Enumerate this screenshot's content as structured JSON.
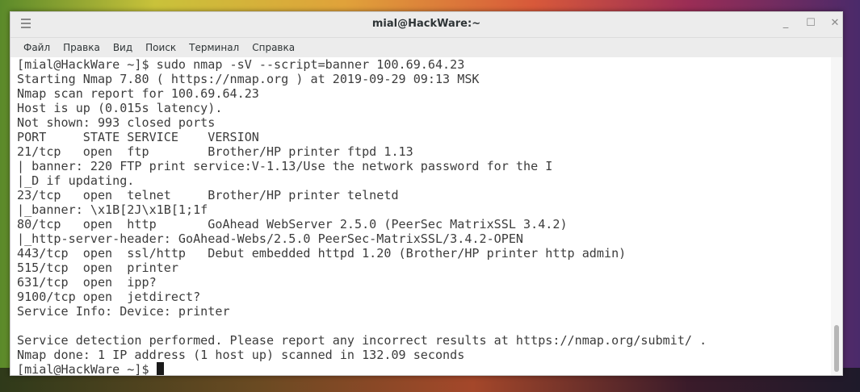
{
  "window": {
    "title": "mial@HackWare:~",
    "controls": {
      "minimize": "_",
      "maximize": "☐",
      "close": "✕"
    }
  },
  "menubar": {
    "items": [
      "Файл",
      "Правка",
      "Вид",
      "Поиск",
      "Терминал",
      "Справка"
    ]
  },
  "terminal": {
    "lines": [
      "[mial@HackWare ~]$ sudo nmap -sV --script=banner 100.69.64.23",
      "Starting Nmap 7.80 ( https://nmap.org ) at 2019-09-29 09:13 MSK",
      "Nmap scan report for 100.69.64.23",
      "Host is up (0.015s latency).",
      "Not shown: 993 closed ports",
      "PORT     STATE SERVICE    VERSION",
      "21/tcp   open  ftp        Brother/HP printer ftpd 1.13",
      "| banner: 220 FTP print service:V-1.13/Use the network password for the I",
      "|_D if updating.",
      "23/tcp   open  telnet     Brother/HP printer telnetd",
      "|_banner: \\x1B[2J\\x1B[1;1f",
      "80/tcp   open  http       GoAhead WebServer 2.5.0 (PeerSec MatrixSSL 3.4.2)",
      "|_http-server-header: GoAhead-Webs/2.5.0 PeerSec-MatrixSSL/3.4.2-OPEN",
      "443/tcp  open  ssl/http   Debut embedded httpd 1.20 (Brother/HP printer http admin)",
      "515/tcp  open  printer",
      "631/tcp  open  ipp?",
      "9100/tcp open  jetdirect?",
      "Service Info: Device: printer",
      "",
      "Service detection performed. Please report any incorrect results at https://nmap.org/submit/ .",
      "Nmap done: 1 IP address (1 host up) scanned in 132.09 seconds"
    ],
    "prompt": "[mial@HackWare ~]$ "
  }
}
